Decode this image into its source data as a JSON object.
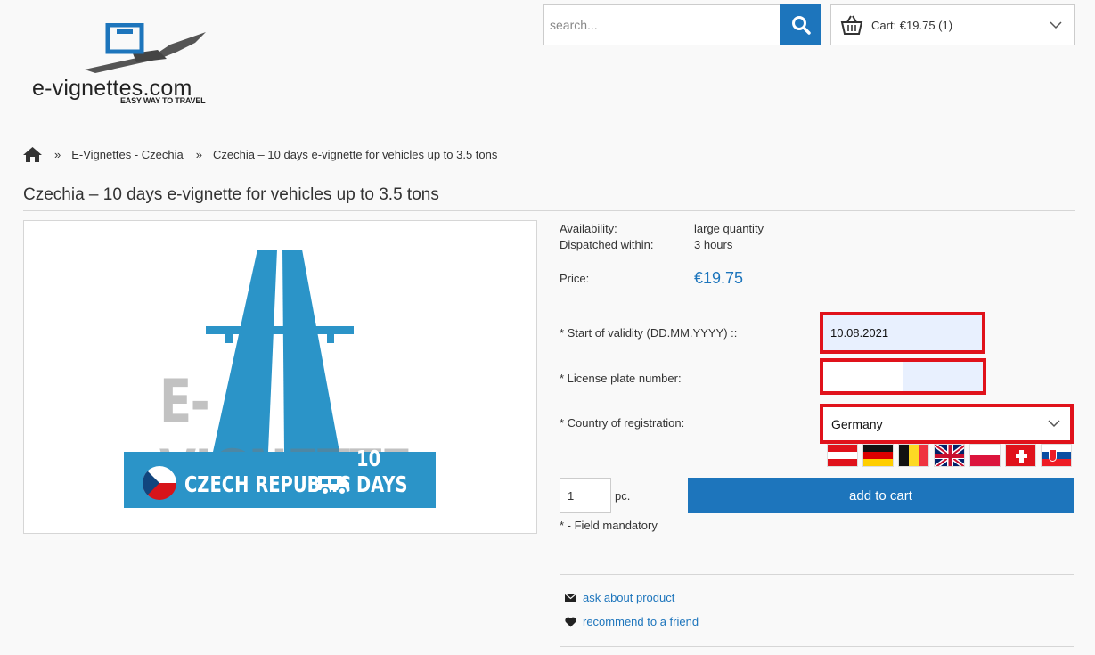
{
  "header": {
    "logo_text": "e-vignettes.com",
    "logo_tagline": "EASY WAY TO TRAVEL",
    "search_placeholder": "search...",
    "cart_label": "Cart: €19.75 (1)"
  },
  "breadcrumb": {
    "sep": "»",
    "items": [
      "E-Vignettes - Czechia",
      "Czechia – 10 days e-vignette for vehicles up to 3.5 tons"
    ]
  },
  "product": {
    "title": "Czechia – 10 days e-vignette for vehicles up to 3.5 tons",
    "image": {
      "watermark": "E-VIGNETTE",
      "country": "CZECH REPUBLIC",
      "duration": "10 DAYS"
    },
    "availability_label": "Availability:",
    "availability_value": "large quantity",
    "dispatch_label": "Dispatched within:",
    "dispatch_value": "3 hours",
    "price_label": "Price:",
    "price_value": "€19.75"
  },
  "form": {
    "start_label": "* Start of validity (DD.MM.YYYY) ::",
    "start_value": "10.08.2021",
    "plate_label": "* License plate number:",
    "plate_value": "",
    "country_label": "* Country of registration:",
    "country_value": "Germany",
    "flags": [
      "austria-flag",
      "germany-flag",
      "belgium-flag",
      "uk-flag",
      "poland-flag",
      "switzerland-flag",
      "slovakia-flag"
    ],
    "qty_value": "1",
    "qty_unit": "pc.",
    "add_button": "add to cart",
    "mandatory_note": "* - Field mandatory"
  },
  "links": {
    "ask": "ask about product",
    "recommend": "recommend to a friend"
  },
  "colors": {
    "accent": "#1d75bc",
    "highlight": "#e0121b",
    "autofill": "#e8f0fe"
  }
}
